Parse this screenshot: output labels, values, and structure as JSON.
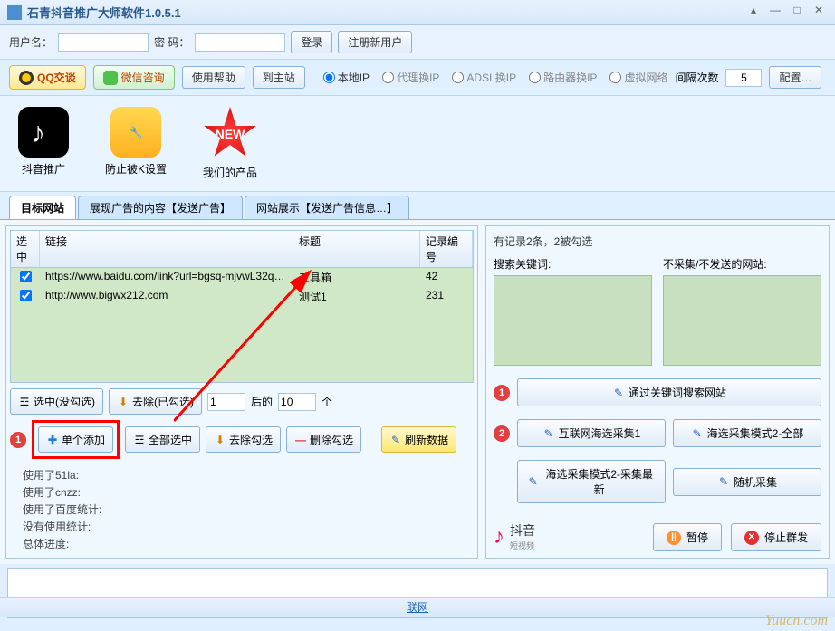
{
  "titlebar": {
    "app_title": "石青抖音推广大师软件1.0.5.1"
  },
  "login": {
    "username_label": "用户名：",
    "password_label": "密    码：",
    "login_btn": "登录",
    "register_btn": "注册新用户"
  },
  "toolbar": {
    "qq_label": "QQ交谈",
    "wx_label": "微信咨询",
    "help_btn": "使用帮助",
    "main_site_btn": "到主站",
    "radios": {
      "local_ip": "本地IP",
      "proxy_ip": "代理换IP",
      "adsl_ip": "ADSL换IP",
      "router_ip": "路由器换IP",
      "virtual_net": "虚拟网络"
    },
    "interval_label": "间隔次数",
    "interval_value": "5",
    "config_btn": "配置…"
  },
  "icons": {
    "douyin_promo": "抖音推广",
    "anti_k": "防止被K设置",
    "our_products": "我们的产品",
    "new_badge": "NEW"
  },
  "tabs": {
    "tab1": "目标网站",
    "tab2": "展现广告的内容【发送广告】",
    "tab3": "网站展示【发送广告信息…】"
  },
  "table": {
    "headers": {
      "check": "选中",
      "link": "链接",
      "title": "标题",
      "id": "记录编号"
    },
    "rows": [
      {
        "link": "https://www.baidu.com/link?url=bgsq-mjvwL32q…",
        "title": "工具箱",
        "id": "42"
      },
      {
        "link": "http://www.bigwx212.com",
        "title": "测试1",
        "id": "231"
      }
    ]
  },
  "left_buttons": {
    "select_unchecked": "选中(没勾选)",
    "remove_checked": "去除(已勾选)",
    "range_start": "1",
    "range_mid_label": "后的",
    "range_end": "10",
    "range_unit": "个",
    "add_single": "单个添加",
    "select_all": "全部选中",
    "remove_check": "去除勾选",
    "delete_check": "删除勾选",
    "refresh_data": "刷新数据"
  },
  "status": {
    "line1": "使用了51la:",
    "line2": "使用了cnzz:",
    "line3": "使用了百度统计:",
    "line4": "没有使用统计:",
    "line5": "总体进度:"
  },
  "right": {
    "summary": "有记录2条，2被勾选",
    "search_keyword_label": "搜索关键词:",
    "no_collect_label": "不采集/不发送的网站:",
    "search_by_keyword": "通过关键词搜索网站",
    "internet_collect": "互联网海选采集1",
    "hx_mode2_all": "海选采集模式2-全部",
    "hx_mode2_latest": "海选采集模式2-采集最新",
    "random_collect": "随机采集",
    "douyin_text": "抖音",
    "douyin_sub": "短视频",
    "pause_btn": "暂停",
    "stop_btn": "停止群发"
  },
  "footer": {
    "center": "联网"
  },
  "watermark": "Yuucn.com"
}
